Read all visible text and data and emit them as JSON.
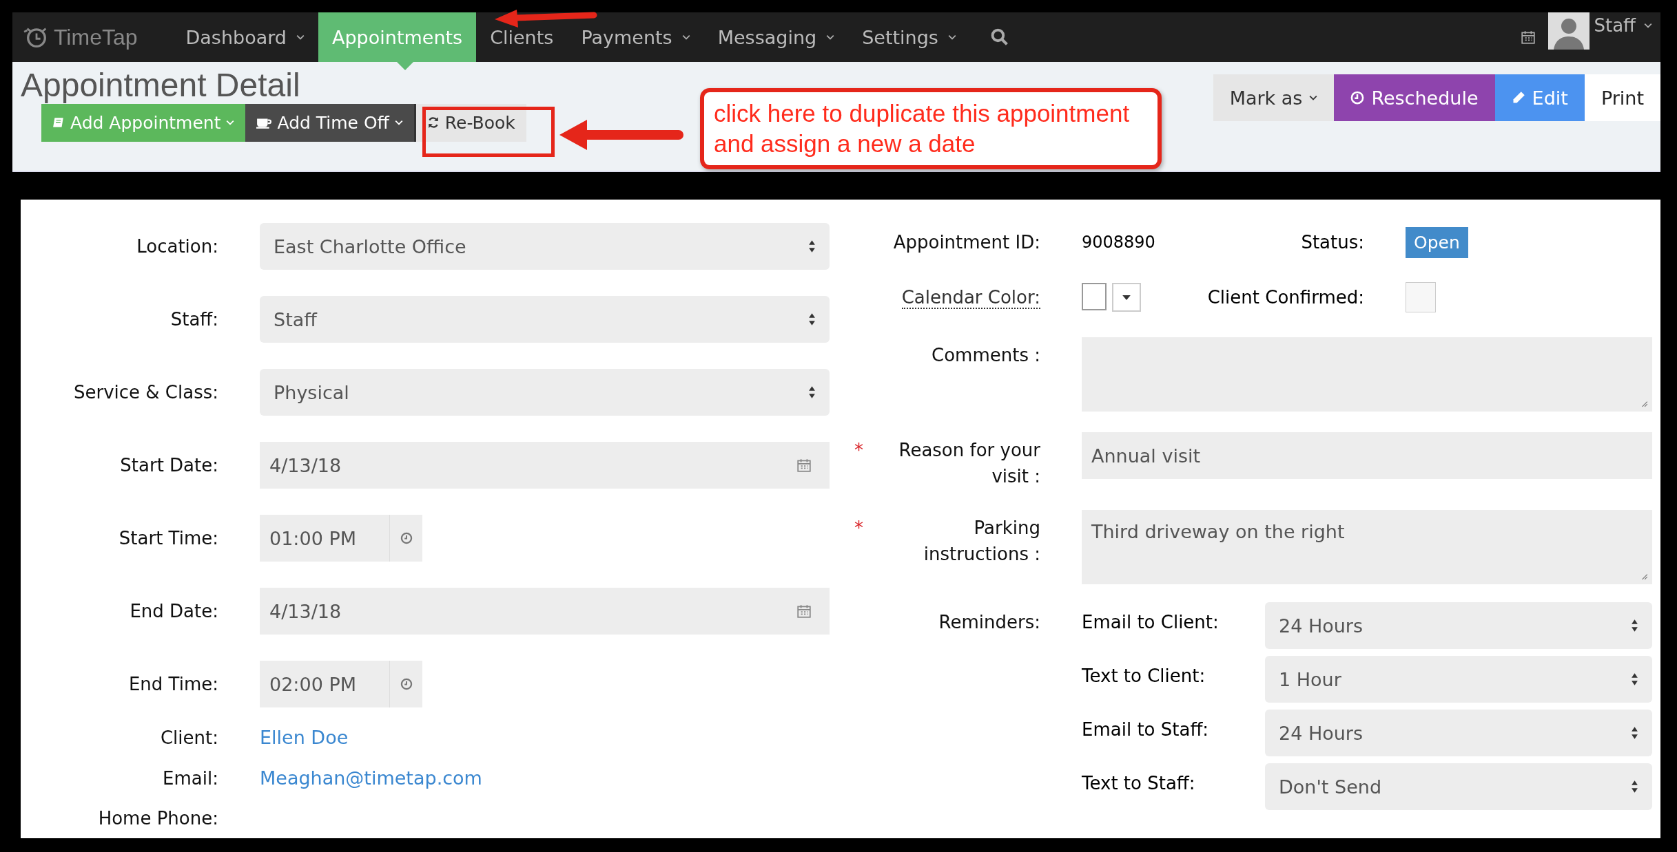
{
  "nav": {
    "logo": "TimeTap",
    "items": [
      {
        "label": "Dashboard",
        "dropdown": true,
        "selected": false
      },
      {
        "label": "Appointments",
        "dropdown": false,
        "selected": true
      },
      {
        "label": "Clients",
        "dropdown": false,
        "selected": false
      },
      {
        "label": "Payments",
        "dropdown": true,
        "selected": false
      },
      {
        "label": "Messaging",
        "dropdown": true,
        "selected": false
      },
      {
        "label": "Settings",
        "dropdown": true,
        "selected": false
      }
    ],
    "user": "Staff"
  },
  "header": {
    "title": "Appointment Detail",
    "actions": [
      {
        "label": "Add Appointment",
        "kind": "add",
        "dropdown": true
      },
      {
        "label": "Add Time Off",
        "kind": "timeoff",
        "dropdown": true
      },
      {
        "label": "Re-Book",
        "kind": "rebook",
        "dropdown": false
      }
    ],
    "right_actions": [
      {
        "label": "Mark as",
        "kind": "mark",
        "dropdown": true
      },
      {
        "label": "Reschedule",
        "kind": "reschedule",
        "dropdown": false
      },
      {
        "label": "Edit",
        "kind": "edit",
        "dropdown": false
      },
      {
        "label": "Print",
        "kind": "print",
        "dropdown": false
      }
    ]
  },
  "annotation": {
    "lines": [
      "click here to duplicate this appointment",
      "and assign a new a date"
    ]
  },
  "left_fields": [
    {
      "label": "Location:",
      "kind": "select",
      "value": "East Charlotte Office"
    },
    {
      "label": "Staff:",
      "kind": "select",
      "value": "Staff"
    },
    {
      "label": "Service & Class:",
      "kind": "select",
      "value": "Physical"
    },
    {
      "label": "Start Date:",
      "kind": "date",
      "value": "4/13/18"
    },
    {
      "label": "Start Time:",
      "kind": "time",
      "value": "01:00 PM"
    },
    {
      "label": "End Date:",
      "kind": "date",
      "value": "4/13/18"
    },
    {
      "label": "End Time:",
      "kind": "time",
      "value": "02:00 PM"
    },
    {
      "label": "Client:",
      "kind": "link",
      "value": "Ellen Doe"
    },
    {
      "label": "Email:",
      "kind": "link",
      "value": "Meaghan@timetap.com"
    },
    {
      "label": "Home Phone:",
      "kind": "text"
    }
  ],
  "details": {
    "id_label": "Appointment ID:",
    "id_value": "9008890",
    "status_label": "Status:",
    "status": "Open",
    "color_label": "Calendar Color:",
    "confirmed_label": "Client Confirmed:",
    "confirmed": false
  },
  "right_fields": [
    {
      "label": "Comments :",
      "kind": "textarea",
      "required": false
    },
    {
      "label": "Reason for your visit :",
      "kind": "input",
      "required": true,
      "value": "Annual visit"
    },
    {
      "label": "Parking instructions :",
      "kind": "textarea",
      "required": true,
      "value": "Third driveway on the right"
    }
  ],
  "required_mark": "*",
  "reminders": {
    "label": "Reminders:",
    "items": [
      {
        "label": "Email to Client:",
        "value": "24 Hours"
      },
      {
        "label": "Text to Client:",
        "value": "1 Hour"
      },
      {
        "label": "Email to Staff:",
        "value": "24 Hours"
      },
      {
        "label": "Text to Staff:",
        "value": "Don't Send"
      }
    ]
  }
}
